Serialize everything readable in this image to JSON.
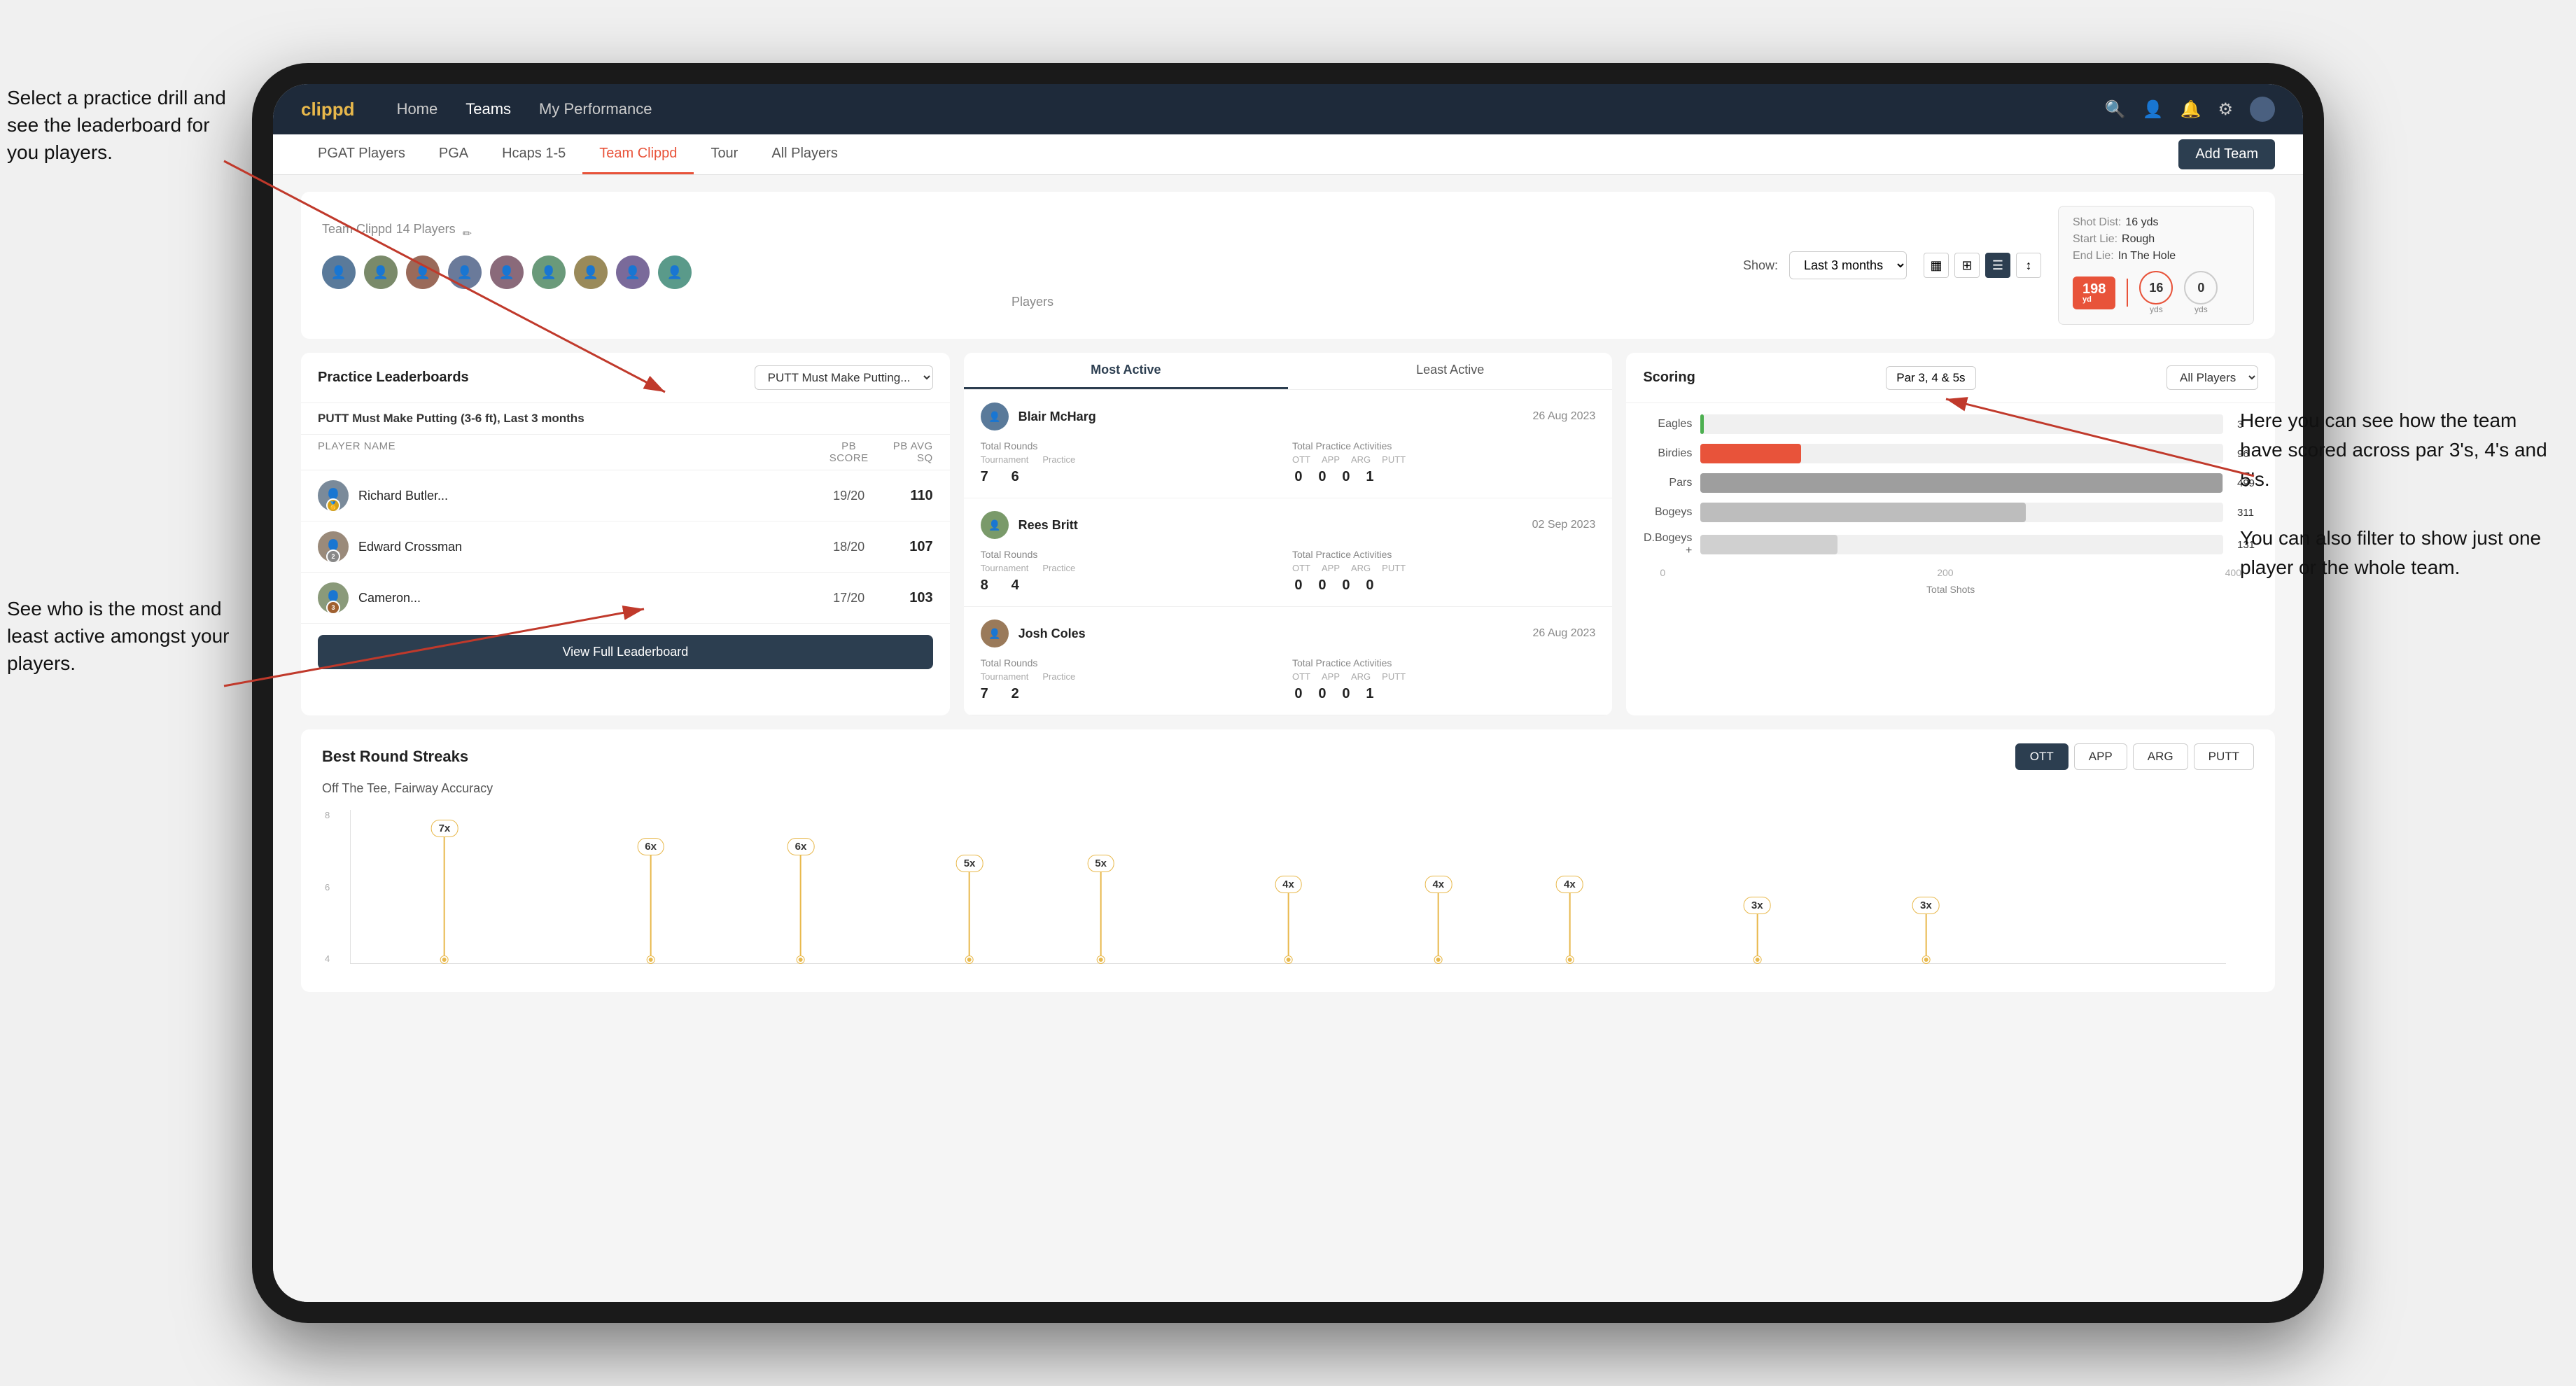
{
  "annotations": {
    "top_left": "Select a practice drill and see the leaderboard for you players.",
    "bottom_left": "See who is the most and least active amongst your players.",
    "right": "Here you can see how the team have scored across par 3's, 4's and 5's.\n\nYou can also filter to show just one player or the whole team."
  },
  "navbar": {
    "brand": "clippd",
    "links": [
      "Home",
      "Teams",
      "My Performance"
    ],
    "active": "Teams"
  },
  "subnav": {
    "items": [
      "PGAT Players",
      "PGA",
      "Hcaps 1-5",
      "Team Clippd",
      "Tour",
      "All Players"
    ],
    "active": "Team Clippd",
    "add_team_label": "Add Team"
  },
  "team_header": {
    "title": "Team Clippd",
    "player_count": "14 Players",
    "show_label": "Show:",
    "show_period": "Last 3 months",
    "players_label": "Players"
  },
  "shot_card": {
    "shot_dist_label": "Shot Dist:",
    "shot_dist_val": "16 yds",
    "start_lie_label": "Start Lie:",
    "start_lie_val": "Rough",
    "end_lie_label": "End Lie:",
    "end_lie_val": "In The Hole",
    "number": "198",
    "unit": "yd",
    "left_yards": "16",
    "right_yards": "0"
  },
  "practice_leaderboards": {
    "panel_title": "Practice Leaderboards",
    "dropdown": "PUTT Must Make Putting...",
    "subtitle": "PUTT Must Make Putting (3-6 ft),",
    "period": "Last 3 months",
    "columns": {
      "player_name": "PLAYER NAME",
      "pb_score": "PB SCORE",
      "pb_avg_sq": "PB AVG SQ"
    },
    "rows": [
      {
        "rank": 1,
        "name": "Richard Butler...",
        "score": "19/20",
        "avg": "110",
        "badge_type": "gold",
        "badge_num": ""
      },
      {
        "rank": 2,
        "name": "Edward Crossman",
        "score": "18/20",
        "avg": "107",
        "badge_type": "silver",
        "badge_num": "2"
      },
      {
        "rank": 3,
        "name": "Cameron...",
        "score": "17/20",
        "avg": "103",
        "badge_type": "bronze",
        "badge_num": "3"
      }
    ],
    "view_btn": "View Full Leaderboard"
  },
  "activity": {
    "tabs": [
      "Most Active",
      "Least Active"
    ],
    "active_tab": "Most Active",
    "players": [
      {
        "name": "Blair McHarg",
        "date": "26 Aug 2023",
        "total_rounds_label": "Total Rounds",
        "tournament_label": "Tournament",
        "practice_label": "Practice",
        "tournament_val": "7",
        "practice_val": "6",
        "activities_label": "Total Practice Activities",
        "ott_label": "OTT",
        "app_label": "APP",
        "arg_label": "ARG",
        "putt_label": "PUTT",
        "ott_val": "0",
        "app_val": "0",
        "arg_val": "0",
        "putt_val": "1"
      },
      {
        "name": "Rees Britt",
        "date": "02 Sep 2023",
        "total_rounds_label": "Total Rounds",
        "tournament_label": "Tournament",
        "practice_label": "Practice",
        "tournament_val": "8",
        "practice_val": "4",
        "activities_label": "Total Practice Activities",
        "ott_label": "OTT",
        "app_label": "APP",
        "arg_label": "ARG",
        "putt_label": "PUTT",
        "ott_val": "0",
        "app_val": "0",
        "arg_val": "0",
        "putt_val": "0"
      },
      {
        "name": "Josh Coles",
        "date": "26 Aug 2023",
        "total_rounds_label": "Total Rounds",
        "tournament_label": "Tournament",
        "practice_label": "Practice",
        "tournament_val": "7",
        "practice_val": "2",
        "activities_label": "Total Practice Activities",
        "ott_label": "OTT",
        "app_label": "APP",
        "arg_label": "ARG",
        "putt_label": "PUTT",
        "ott_val": "0",
        "app_val": "0",
        "arg_val": "0",
        "putt_val": "1"
      }
    ]
  },
  "scoring": {
    "title": "Scoring",
    "filter1": "Par 3, 4 & 5s",
    "filter2": "All Players",
    "bars": [
      {
        "label": "Eagles",
        "value": 3,
        "max": 500,
        "color_class": "bar-eagles",
        "display": "3"
      },
      {
        "label": "Birdies",
        "value": 96,
        "max": 500,
        "color_class": "bar-birdies",
        "display": "96"
      },
      {
        "label": "Pars",
        "value": 499,
        "max": 500,
        "color_class": "bar-pars",
        "display": "499"
      },
      {
        "label": "Bogeys",
        "value": 311,
        "max": 500,
        "color_class": "bar-bogeys",
        "display": "311"
      },
      {
        "label": "D.Bogeys +",
        "value": 131,
        "max": 500,
        "color_class": "bar-dbogeys",
        "display": "131"
      }
    ],
    "axis_labels": [
      "0",
      "200",
      "400"
    ],
    "x_label": "Total Shots"
  },
  "streaks": {
    "title": "Best Round Streaks",
    "filters": [
      "OTT",
      "APP",
      "ARG",
      "PUTT"
    ],
    "active_filter": "OTT",
    "subtitle": "Off The Tee, Fairway Accuracy",
    "pins": [
      {
        "label": "7x",
        "left_pct": 5,
        "height_pct": 85
      },
      {
        "label": "6x",
        "left_pct": 16,
        "height_pct": 72
      },
      {
        "label": "6x",
        "left_pct": 24,
        "height_pct": 72
      },
      {
        "label": "5x",
        "left_pct": 33,
        "height_pct": 60
      },
      {
        "label": "5x",
        "left_pct": 40,
        "height_pct": 60
      },
      {
        "label": "4x",
        "left_pct": 50,
        "height_pct": 45
      },
      {
        "label": "4x",
        "left_pct": 57,
        "height_pct": 45
      },
      {
        "label": "4x",
        "left_pct": 64,
        "height_pct": 45
      },
      {
        "label": "3x",
        "left_pct": 74,
        "height_pct": 30
      },
      {
        "label": "3x",
        "left_pct": 82,
        "height_pct": 30
      }
    ]
  }
}
